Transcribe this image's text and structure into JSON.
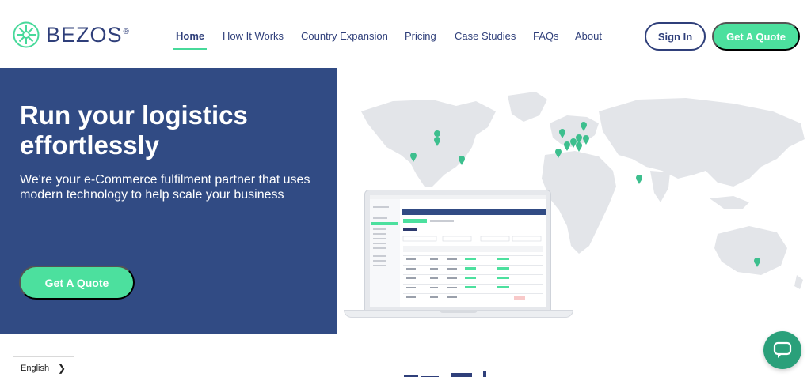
{
  "brand": {
    "name": "BEZOS",
    "registered": "®",
    "logo_icon": "bezos-logo-icon"
  },
  "nav": {
    "items": [
      {
        "label": "Home",
        "active": true
      },
      {
        "label": "How It Works",
        "active": false
      },
      {
        "label": "Country Expansion",
        "active": false
      },
      {
        "label": "Pricing",
        "active": false
      },
      {
        "label": "Case Studies",
        "active": false
      },
      {
        "label": "FAQs",
        "active": false
      },
      {
        "label": "About",
        "active": false
      }
    ],
    "sign_in_label": "Sign In",
    "get_quote_label": "Get A Quote"
  },
  "hero": {
    "title": "Run your logistics effortlessly",
    "subtitle": "We're your e-Commerce fulfilment partner that uses modern technology to help scale your business",
    "cta_label": "Get A Quote"
  },
  "language": {
    "selected": "English",
    "icon": "chevron-right-icon"
  },
  "chat": {
    "icon": "chat-bubble-icon"
  },
  "colors": {
    "navy": "#2f3f7a",
    "hero_bg": "#314b84",
    "accent_green": "#4ce09e",
    "chat_green": "#2aa07a",
    "map_grey": "#e3e5e9",
    "pin_green": "#3dbf8e"
  }
}
